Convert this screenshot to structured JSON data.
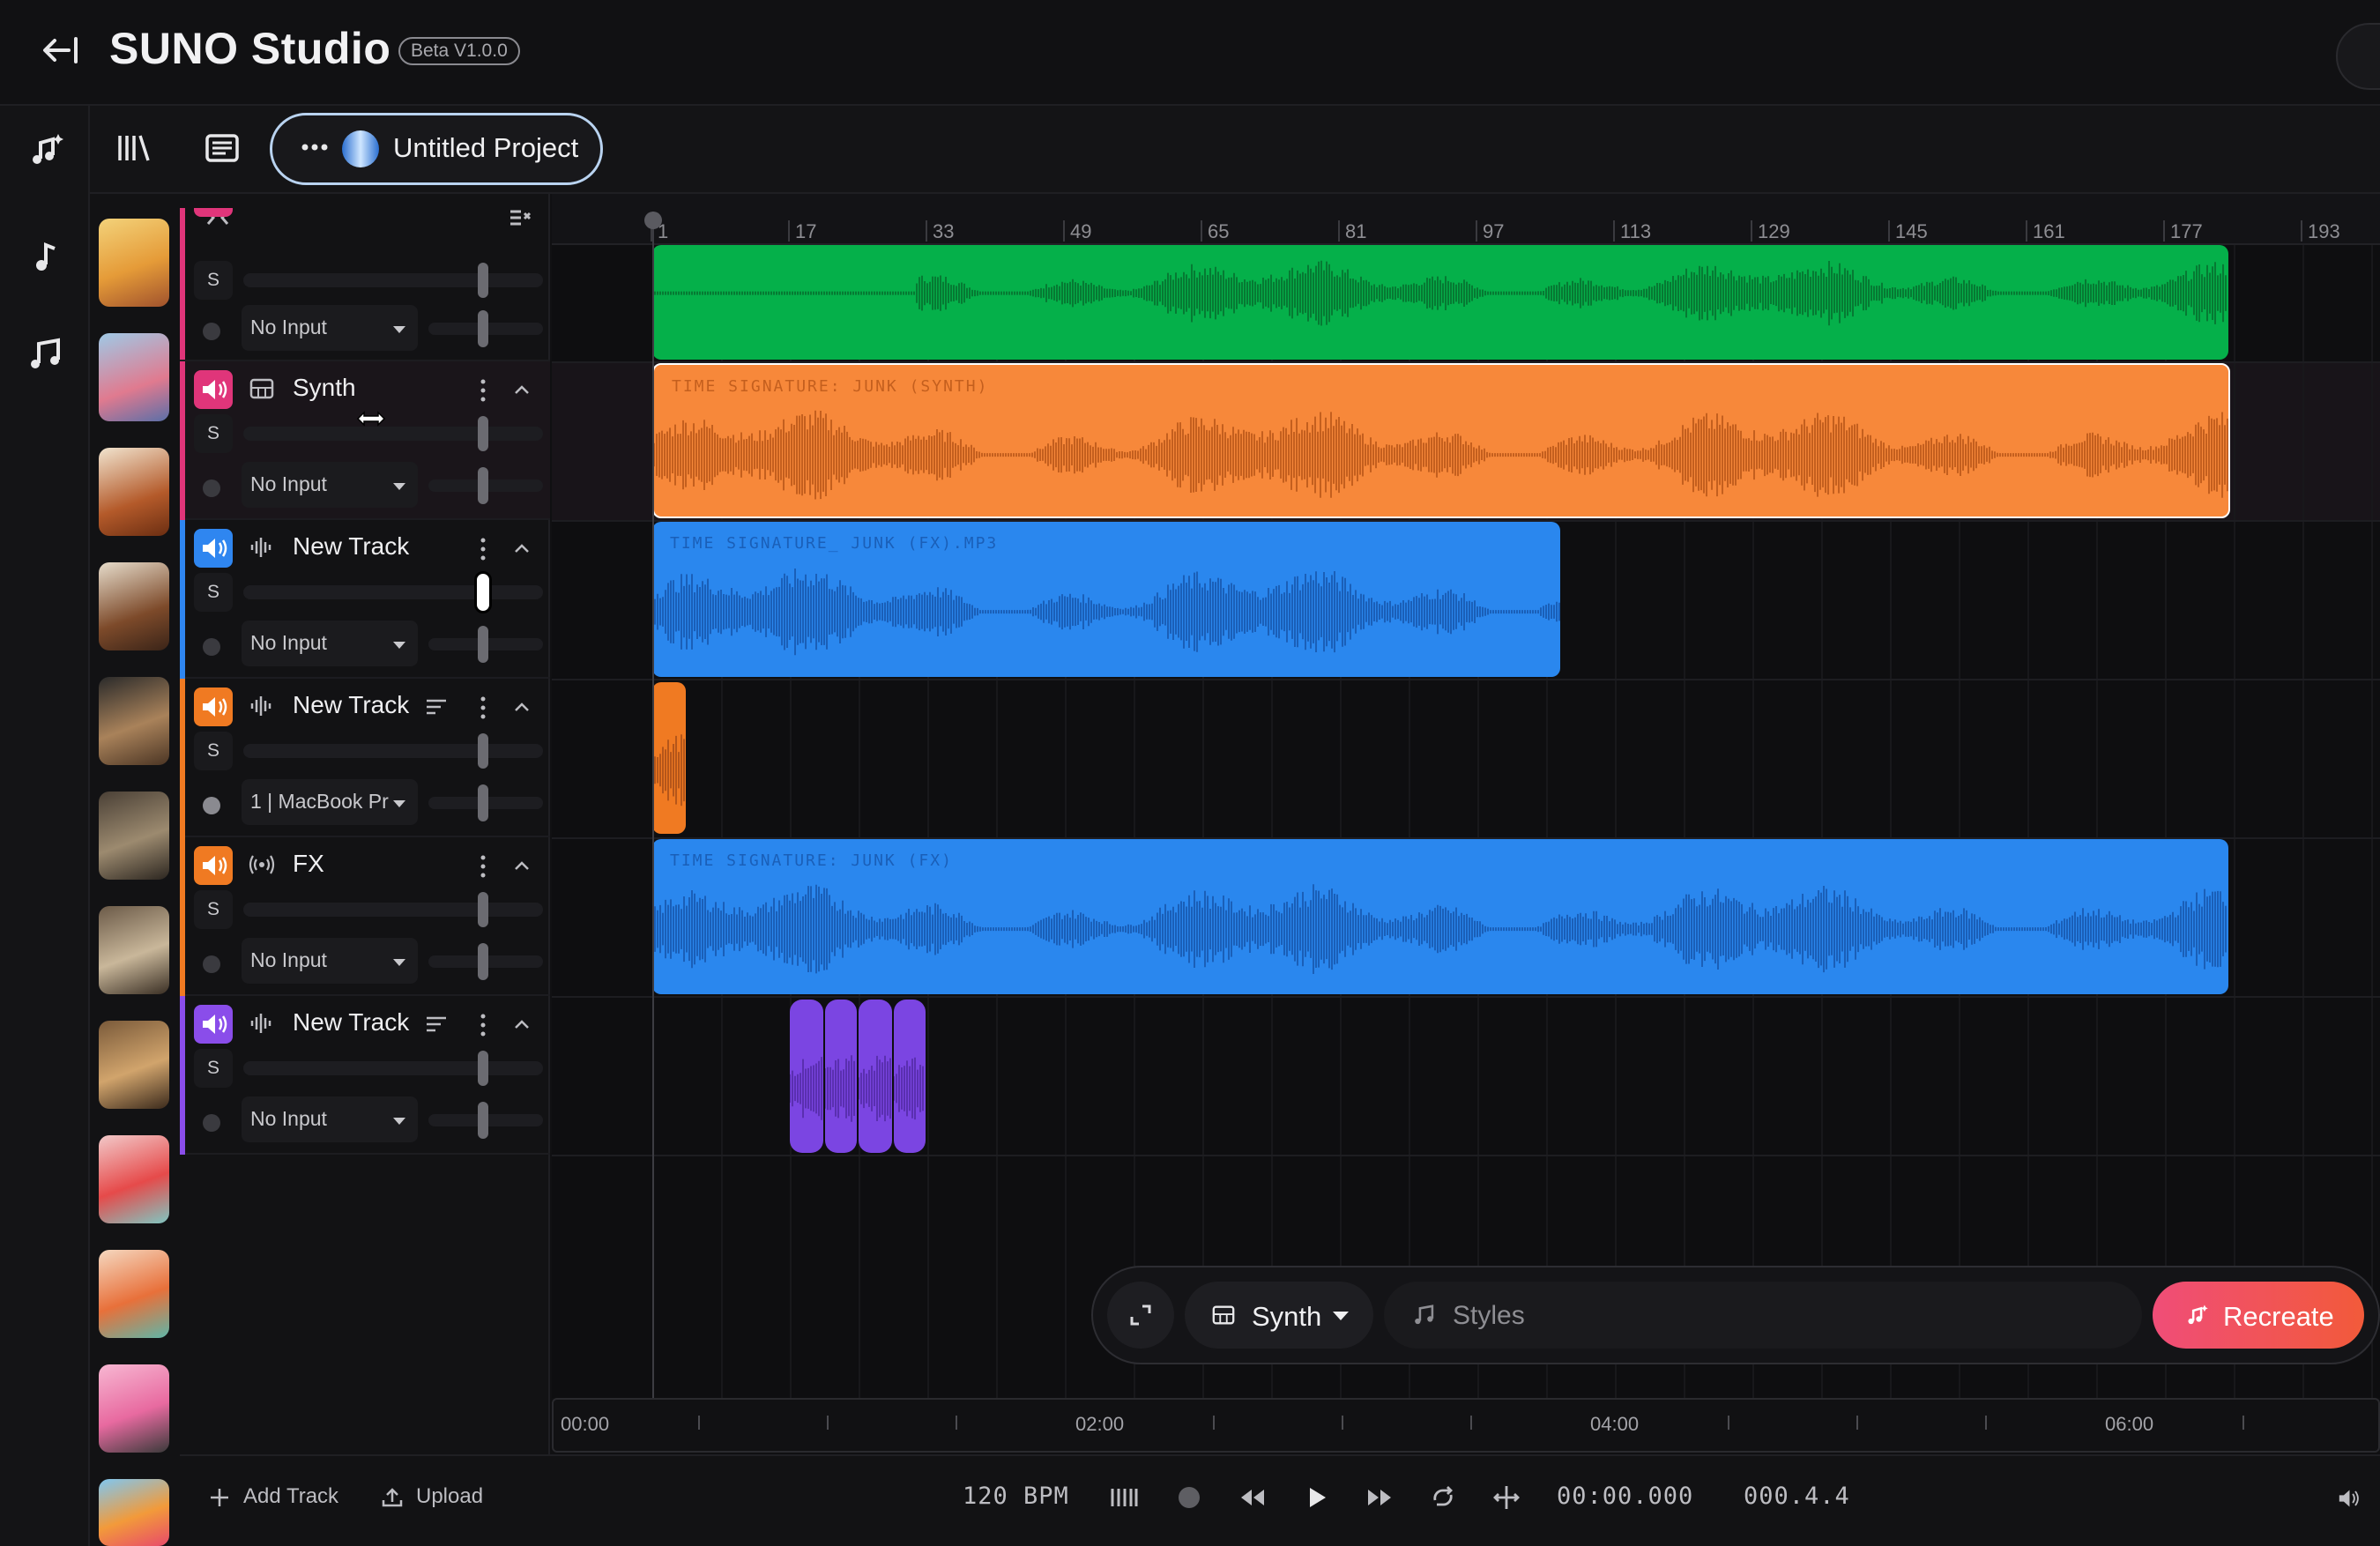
{
  "header": {
    "app_title": "SUNO Studio",
    "beta_badge": "Beta V1.0.0"
  },
  "project_tab": {
    "name": "Untitled Project"
  },
  "tracks": [
    {
      "name": "",
      "input": "No Input",
      "color": "#e0357a",
      "type_icon": "waveform-icon"
    },
    {
      "name": "Synth",
      "input": "No Input",
      "color": "#e0357a",
      "type_icon": "keyboard-icon"
    },
    {
      "name": "New Track",
      "input": "No Input",
      "color": "#2f86f0",
      "type_icon": "waveform-icon"
    },
    {
      "name": "New Track",
      "input": "1 | MacBook Pr",
      "color": "#f07a22",
      "type_icon": "waveform-icon"
    },
    {
      "name": "FX",
      "input": "No Input",
      "color": "#f07a22",
      "type_icon": "broadcast-icon"
    },
    {
      "name": "New Track",
      "input": "No Input",
      "color": "#8a4dea",
      "type_icon": "waveform-icon"
    }
  ],
  "solo_label": "S",
  "ruler": {
    "bars": [
      "1",
      "17",
      "33",
      "49",
      "65",
      "81",
      "97",
      "113",
      "129",
      "145",
      "161",
      "177",
      "193"
    ]
  },
  "clips": [
    {
      "label": "",
      "color": "#05b04a",
      "wave": "#067a33"
    },
    {
      "label": "TIME SIGNATURE: JUNK (SYNTH)",
      "color": "#f7883a",
      "wave": "#c45f1e"
    },
    {
      "label": "TIME SIGNATURE_ JUNK (FX).MP3",
      "color": "#2a87ee",
      "wave": "#1a5fb8"
    },
    {
      "label": "",
      "color": "#f07a22",
      "wave": "#b5561a"
    },
    {
      "label": "TIME SIGNATURE: JUNK (FX)",
      "color": "#2a87ee",
      "wave": "#1a5fb8"
    },
    {
      "label": "",
      "color": "#7b45e2",
      "wave": "#5a2fb0"
    }
  ],
  "overview": {
    "times": [
      "00:00",
      "02:00",
      "04:00",
      "06:00"
    ]
  },
  "prompt": {
    "track": "Synth",
    "styles_placeholder": "Styles",
    "recreate": "Recreate"
  },
  "transport": {
    "add_track": "Add Track",
    "upload": "Upload",
    "bpm": "120 BPM",
    "time": "00:00.000",
    "position": "000.4.4"
  }
}
